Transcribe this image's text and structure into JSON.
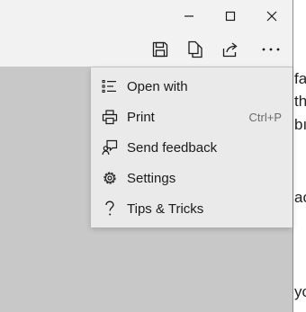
{
  "window_controls": {
    "minimize_icon": "minimize-icon",
    "maximize_icon": "maximize-icon",
    "close_icon": "close-icon"
  },
  "toolbar": {
    "buttons": [
      {
        "icon": "save-icon"
      },
      {
        "icon": "copy-icon"
      },
      {
        "icon": "share-icon"
      },
      {
        "icon": "more-icon"
      }
    ]
  },
  "background_text": {
    "lines": [
      "fa",
      "th",
      "bı",
      "ac",
      "yo"
    ]
  },
  "menu": {
    "items": [
      {
        "label": "Open with",
        "icon": "open-with-icon",
        "shortcut": ""
      },
      {
        "label": "Print",
        "icon": "printer-icon",
        "shortcut": "Ctrl+P"
      },
      {
        "label": "Send feedback",
        "icon": "feedback-icon",
        "shortcut": ""
      },
      {
        "label": "Settings",
        "icon": "gear-icon",
        "shortcut": ""
      },
      {
        "label": "Tips & Tricks",
        "icon": "question-icon",
        "shortcut": ""
      }
    ]
  },
  "colors": {
    "menu_background": "#eaeaea",
    "chrome_background": "#f2f2f2",
    "canvas_background": "#c8c8c8"
  }
}
